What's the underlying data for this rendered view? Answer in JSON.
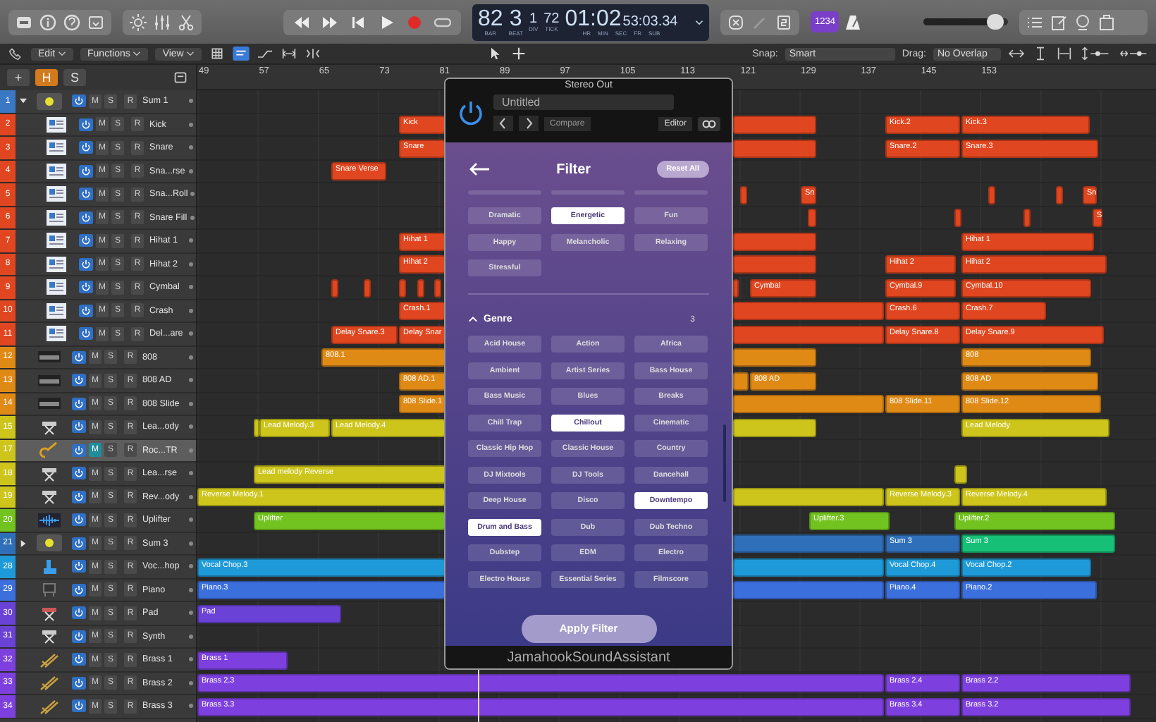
{
  "transport": {
    "count_in": "1234",
    "master_volume": {
      "level": 0.85
    }
  },
  "lcd": {
    "bar": "82",
    "beat": "3",
    "div": "1",
    "tick": "72",
    "time": "01:02",
    "frames": "53:03.34",
    "labels": [
      "BAR",
      "BEAT",
      "DIV",
      "TICK",
      "HR",
      "MIN",
      "SEC",
      "FR",
      "SUB"
    ]
  },
  "toolbar": {
    "menus": [
      "Edit",
      "Functions",
      "View"
    ],
    "snap_label": "Snap:",
    "snap": "Smart",
    "drag_label": "Drag:",
    "drag": "No Overlap"
  },
  "header_buttons": [
    {
      "label": "+",
      "selected": false
    },
    {
      "label": "H",
      "selected": true
    },
    {
      "label": "S",
      "selected": false
    }
  ],
  "ruler": [
    "49",
    "57",
    "65",
    "73",
    "81",
    "89",
    "97",
    "105",
    "113",
    "121",
    "129",
    "137",
    "145",
    "153"
  ],
  "tracks": [
    {
      "number": "1",
      "name": "Sum 1",
      "kind": "summing",
      "color": "#3a78c4",
      "selected": false,
      "muted": false,
      "expanded": true,
      "controls": [
        "M",
        "S",
        "R"
      ],
      "children": [
        {
          "number": "2",
          "name": "Kick",
          "kind": "drum",
          "color": "#e0461f",
          "selected": false,
          "muted": false,
          "controls": [
            "M",
            "S",
            "R"
          ],
          "regions": [
            {
              "label": "Kick"
            },
            {
              "label": "Kick.2"
            },
            {
              "label": "Kick.3"
            }
          ]
        },
        {
          "number": "3",
          "name": "Snare",
          "kind": "drum",
          "color": "#e0461f",
          "selected": false,
          "muted": false,
          "controls": [
            "M",
            "S",
            "R"
          ],
          "regions": [
            {
              "label": "Snare"
            },
            {
              "label": "Snare.2"
            },
            {
              "label": "Snare.3"
            }
          ]
        },
        {
          "number": "4",
          "name": "Sna...rse",
          "kind": "drum",
          "color": "#e0461f",
          "selected": false,
          "muted": false,
          "controls": [
            "M",
            "S",
            "R"
          ],
          "regions": [
            {
              "label": "Snare Verse"
            }
          ]
        },
        {
          "number": "5",
          "name": "Sna...Roll",
          "kind": "drum",
          "color": "#e0461f",
          "selected": false,
          "muted": false,
          "controls": [
            "M",
            "S",
            "R"
          ],
          "regions": [
            {
              "label": "Sn"
            },
            {
              "label": "Sn"
            }
          ]
        },
        {
          "number": "6",
          "name": "Snare Fill",
          "kind": "drum",
          "color": "#e0461f",
          "selected": false,
          "muted": false,
          "controls": [
            "M",
            "S",
            "R"
          ],
          "regions": [
            {
              "label": "S"
            }
          ]
        },
        {
          "number": "7",
          "name": "Hihat 1",
          "kind": "drum",
          "color": "#e0461f",
          "selected": false,
          "muted": false,
          "controls": [
            "M",
            "S",
            "R"
          ],
          "regions": [
            {
              "label": "Hihat 1"
            },
            {
              "label": "Hihat 1"
            }
          ]
        },
        {
          "number": "8",
          "name": "Hihat 2",
          "kind": "drum",
          "color": "#e0461f",
          "selected": false,
          "muted": false,
          "controls": [
            "M",
            "S",
            "R"
          ],
          "regions": [
            {
              "label": "Hihat 2"
            },
            {
              "label": "Hihat 2"
            },
            {
              "label": "Hihat 2"
            }
          ]
        },
        {
          "number": "9",
          "name": "Cymbal",
          "kind": "drum",
          "color": "#e0461f",
          "selected": false,
          "muted": false,
          "controls": [
            "M",
            "S",
            "R"
          ],
          "regions": [
            {
              "label": "Cymbal"
            },
            {
              "label": "Cymbal.9"
            },
            {
              "label": "Cymbal.10"
            }
          ]
        },
        {
          "number": "10",
          "name": "Crash",
          "kind": "drum",
          "color": "#e0461f",
          "selected": false,
          "muted": false,
          "controls": [
            "M",
            "S",
            "R"
          ],
          "regions": [
            {
              "label": "Crash.1"
            },
            {
              "label": "Crash.6"
            },
            {
              "label": "Crash.7"
            }
          ]
        },
        {
          "number": "11",
          "name": "Del...are",
          "kind": "drum",
          "color": "#e0461f",
          "selected": false,
          "muted": false,
          "controls": [
            "M",
            "S",
            "R"
          ],
          "regions": [
            {
              "label": "Delay Snare.3"
            },
            {
              "label": "Delay Snar"
            },
            {
              "label": "Delay Snare.8"
            },
            {
              "label": "Delay Snare.9"
            }
          ]
        }
      ]
    },
    {
      "number": "12",
      "name": "808",
      "kind": "keys",
      "color": "#e08a16",
      "selected": false,
      "muted": false,
      "controls": [
        "M",
        "S",
        "R"
      ],
      "regions": [
        {
          "label": "808.1"
        },
        {
          "label": "808"
        }
      ]
    },
    {
      "number": "13",
      "name": "808 AD",
      "kind": "keys",
      "color": "#e08a16",
      "selected": false,
      "muted": false,
      "controls": [
        "M",
        "S",
        "R"
      ],
      "regions": [
        {
          "label": "808 AD.1"
        },
        {
          "label": "808 AD"
        },
        {
          "label": "808 AD"
        }
      ]
    },
    {
      "number": "14",
      "name": "808 Slide",
      "kind": "keys",
      "color": "#e08a16",
      "selected": false,
      "muted": false,
      "controls": [
        "M",
        "S",
        "R"
      ],
      "regions": [
        {
          "label": "808 Slide.1"
        },
        {
          "label": "808 Slide.11"
        },
        {
          "label": "808 Slide.12"
        }
      ]
    },
    {
      "number": "15",
      "name": "Lea...ody",
      "kind": "synth",
      "color": "#cdc51c",
      "selected": false,
      "muted": false,
      "controls": [
        "M",
        "S",
        "R"
      ],
      "regions": [
        {
          "label": "Lead Melody.3"
        },
        {
          "label": "Lead Melody.4"
        },
        {
          "label": "Lead Melody"
        }
      ]
    },
    {
      "number": "17",
      "name": "Roc...TR",
      "kind": "guitar",
      "color": "#cdc51c",
      "selected": true,
      "muted": true,
      "controls": [
        "M",
        "S",
        "R"
      ]
    },
    {
      "number": "18",
      "name": "Lea...rse",
      "kind": "synth",
      "color": "#cdc51c",
      "selected": false,
      "muted": false,
      "controls": [
        "M",
        "S",
        "R"
      ],
      "regions": [
        {
          "label": "Lead melody Reverse"
        }
      ]
    },
    {
      "number": "19",
      "name": "Rev...ody",
      "kind": "synth",
      "color": "#cdc51c",
      "selected": false,
      "muted": false,
      "controls": [
        "M",
        "S",
        "R"
      ],
      "regions": [
        {
          "label": "Reverse Melody.1"
        },
        {
          "label": "Reverse Melody.3"
        },
        {
          "label": "Reverse Melody.4"
        }
      ]
    },
    {
      "number": "20",
      "name": "Uplifter",
      "kind": "audio",
      "color": "#72c31f",
      "selected": false,
      "muted": false,
      "controls": [
        "M",
        "S",
        "R"
      ],
      "regions": [
        {
          "label": "Uplifter"
        },
        {
          "label": "Uplifter.3"
        },
        {
          "label": "Uplifter.2"
        }
      ]
    },
    {
      "number": "21",
      "name": "Sum 3",
      "kind": "summing",
      "color": "#2f6fba",
      "selected": false,
      "muted": false,
      "expanded": false,
      "controls": [
        "M",
        "S",
        "R"
      ],
      "regions": [
        {
          "label": "Sum 3"
        },
        {
          "label": "Sum 3",
          "color": "#16c077"
        }
      ]
    },
    {
      "number": "28",
      "name": "Voc...hop",
      "kind": "vocal",
      "color": "#1f9ad8",
      "selected": false,
      "muted": false,
      "controls": [
        "M",
        "S",
        "R"
      ],
      "regions": [
        {
          "label": "Vocal Chop.3"
        },
        {
          "label": "Vocal Chop.4"
        },
        {
          "label": "Vocal Chop.2"
        }
      ]
    },
    {
      "number": "29",
      "name": "Piano",
      "kind": "piano",
      "color": "#3b6fdc",
      "selected": false,
      "muted": false,
      "controls": [
        "M",
        "S",
        "R"
      ],
      "regions": [
        {
          "label": "Piano.3"
        },
        {
          "label": "Piano.4"
        },
        {
          "label": "Piano.2"
        }
      ]
    },
    {
      "number": "30",
      "name": "Pad",
      "kind": "pad",
      "color": "#6b42d6",
      "selected": false,
      "muted": false,
      "controls": [
        "M",
        "S",
        "R"
      ],
      "regions": [
        {
          "label": "Pad"
        }
      ]
    },
    {
      "number": "31",
      "name": "Synth",
      "kind": "synth",
      "color": "#6b42d6",
      "selected": false,
      "muted": false,
      "controls": [
        "M",
        "S",
        "R"
      ]
    },
    {
      "number": "32",
      "name": "Brass 1",
      "kind": "brass",
      "color": "#7d40de",
      "selected": false,
      "muted": false,
      "controls": [
        "M",
        "S",
        "R"
      ],
      "regions": [
        {
          "label": "Brass 1"
        }
      ]
    },
    {
      "number": "33",
      "name": "Brass 2",
      "kind": "brass",
      "color": "#7d40de",
      "selected": false,
      "muted": false,
      "controls": [
        "M",
        "S",
        "R"
      ],
      "regions": [
        {
          "label": "Brass 2.3"
        },
        {
          "label": "Brass 2.4"
        },
        {
          "label": "Brass 2.2"
        }
      ]
    },
    {
      "number": "34",
      "name": "Brass 3",
      "kind": "brass",
      "color": "#7d40de",
      "selected": false,
      "muted": false,
      "controls": [
        "M",
        "S",
        "R"
      ],
      "regions": [
        {
          "label": "Brass 3.3"
        },
        {
          "label": "Brass 3.4"
        },
        {
          "label": "Brass 3.2"
        }
      ]
    }
  ],
  "plugin": {
    "title": "Stereo Out",
    "preset": "Untitled",
    "compare": "Compare",
    "mode": "Editor",
    "heading": "Filter",
    "reset": "Reset All",
    "moods": [
      {
        "label": "Dramatic",
        "selected": false
      },
      {
        "label": "Energetic",
        "selected": true
      },
      {
        "label": "Fun",
        "selected": false
      },
      {
        "label": "Happy",
        "selected": false
      },
      {
        "label": "Melancholic",
        "selected": false
      },
      {
        "label": "Relaxing",
        "selected": false
      },
      {
        "label": "Stressful",
        "selected": false
      }
    ],
    "genre": {
      "title": "Genre",
      "count": "3",
      "expanded": true,
      "tags": [
        {
          "label": "Acid House",
          "selected": false
        },
        {
          "label": "Action",
          "selected": false
        },
        {
          "label": "Africa",
          "selected": false
        },
        {
          "label": "Ambient",
          "selected": false
        },
        {
          "label": "Artist Series",
          "selected": false
        },
        {
          "label": "Bass House",
          "selected": false
        },
        {
          "label": "Bass Music",
          "selected": false
        },
        {
          "label": "Blues",
          "selected": false
        },
        {
          "label": "Breaks",
          "selected": false
        },
        {
          "label": "Chill Trap",
          "selected": false
        },
        {
          "label": "Chillout",
          "selected": true
        },
        {
          "label": "Cinematic",
          "selected": false
        },
        {
          "label": "Classic Hip Hop",
          "selected": false
        },
        {
          "label": "Classic House",
          "selected": false
        },
        {
          "label": "Country",
          "selected": false
        },
        {
          "label": "DJ Mixtools",
          "selected": false
        },
        {
          "label": "DJ Tools",
          "selected": false
        },
        {
          "label": "Dancehall",
          "selected": false
        },
        {
          "label": "Deep House",
          "selected": false
        },
        {
          "label": "Disco",
          "selected": false
        },
        {
          "label": "Downtempo",
          "selected": true
        },
        {
          "label": "Drum and Bass",
          "selected": true
        },
        {
          "label": "Dub",
          "selected": false
        },
        {
          "label": "Dub Techno",
          "selected": false
        },
        {
          "label": "Dubstep",
          "selected": false
        },
        {
          "label": "EDM",
          "selected": false
        },
        {
          "label": "Electro",
          "selected": false
        },
        {
          "label": "Electro House",
          "selected": false
        },
        {
          "label": "Essential Series",
          "selected": false
        },
        {
          "label": "Filmscore",
          "selected": false
        }
      ]
    },
    "apply": "Apply Filter",
    "footer": "JamahookSoundAssistant"
  }
}
